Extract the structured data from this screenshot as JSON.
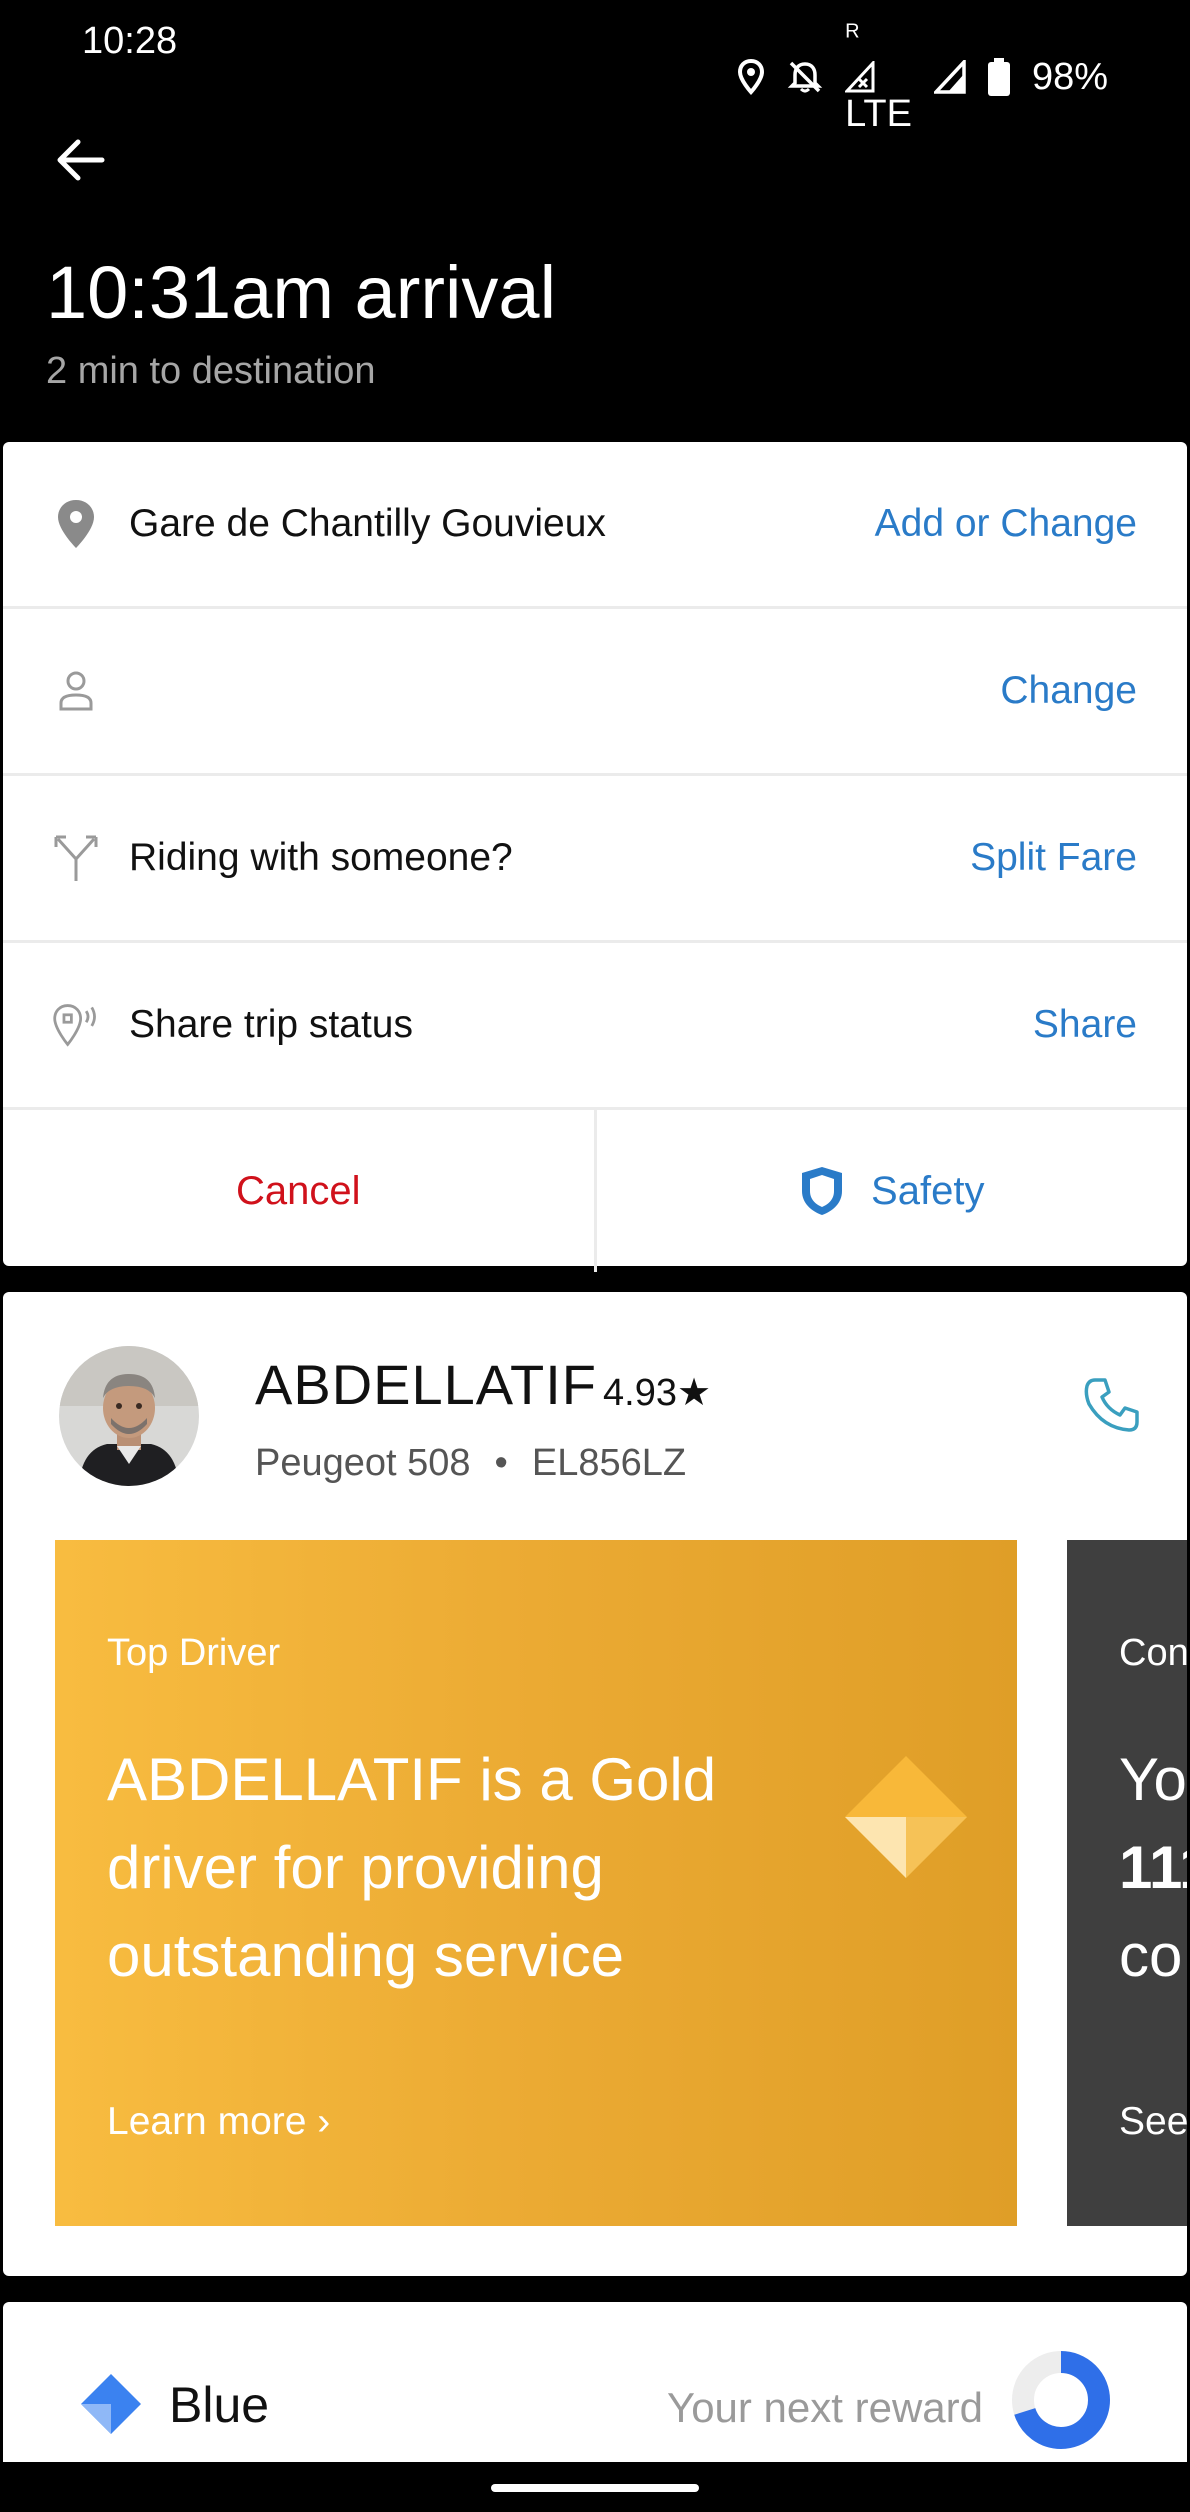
{
  "status_bar": {
    "time": "10:28",
    "network": "LTE",
    "roaming": "R",
    "battery": "98%"
  },
  "header": {
    "arrival": "10:31am arrival",
    "eta": "2 min to destination"
  },
  "trip": {
    "destination": {
      "label": "Gare de Chantilly Gouvieux",
      "action": "Add or Change"
    },
    "rider": {
      "label": "",
      "action": "Change"
    },
    "split": {
      "label": "Riding with someone?",
      "action": "Split Fare"
    },
    "share": {
      "label": "Share trip status",
      "action": "Share"
    },
    "cancel": "Cancel",
    "safety": "Safety"
  },
  "driver": {
    "name": "ABDELLATIF",
    "rating": "4.93★",
    "car": "Peugeot 508",
    "separator": "•",
    "plate": "EL856LZ"
  },
  "gold_card": {
    "eyebrow": "Top Driver",
    "headline": "ABDELLATIF is a Gold driver for providing outstanding service",
    "link": "Learn more ›"
  },
  "next_card": {
    "eyebrow": "Con",
    "line1": "Yo",
    "line2": "111",
    "line3": "co",
    "link": "See"
  },
  "rewards": {
    "tier": "Blue",
    "next_reward": "Your next reward",
    "progress": 0.7
  },
  "colors": {
    "accent_blue": "#2a7bc8",
    "cancel_red": "#d0111b",
    "gold": "#ebaa33",
    "phone_teal": "#3a9fbf"
  }
}
